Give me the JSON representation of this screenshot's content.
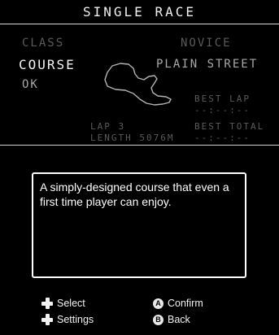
{
  "header": {
    "title": "SINGLE RACE"
  },
  "menu": {
    "class_label": "CLASS",
    "course_label": "COURSE",
    "ok_label": "OK"
  },
  "selection": {
    "class_value": "NOVICE",
    "course_value": "PLAIN STREET"
  },
  "stats": {
    "best_lap_label": "BEST LAP",
    "best_lap_value": "--:--:--",
    "best_total_label": "BEST TOTAL",
    "best_total_value": "--:--:--",
    "lap_label": "LAP 3",
    "length_label": "LENGTH 5076M"
  },
  "dialog": {
    "text": "A simply-designed course that even a first time player can enjoy."
  },
  "controls": {
    "select": {
      "label": "Select",
      "icon": "dpad-icon"
    },
    "settings": {
      "label": "Settings",
      "icon": "dpad-icon"
    },
    "confirm": {
      "label": "Confirm",
      "icon": "a-button-icon",
      "glyph": "A"
    },
    "back": {
      "label": "Back",
      "icon": "b-button-icon",
      "glyph": "B"
    }
  }
}
